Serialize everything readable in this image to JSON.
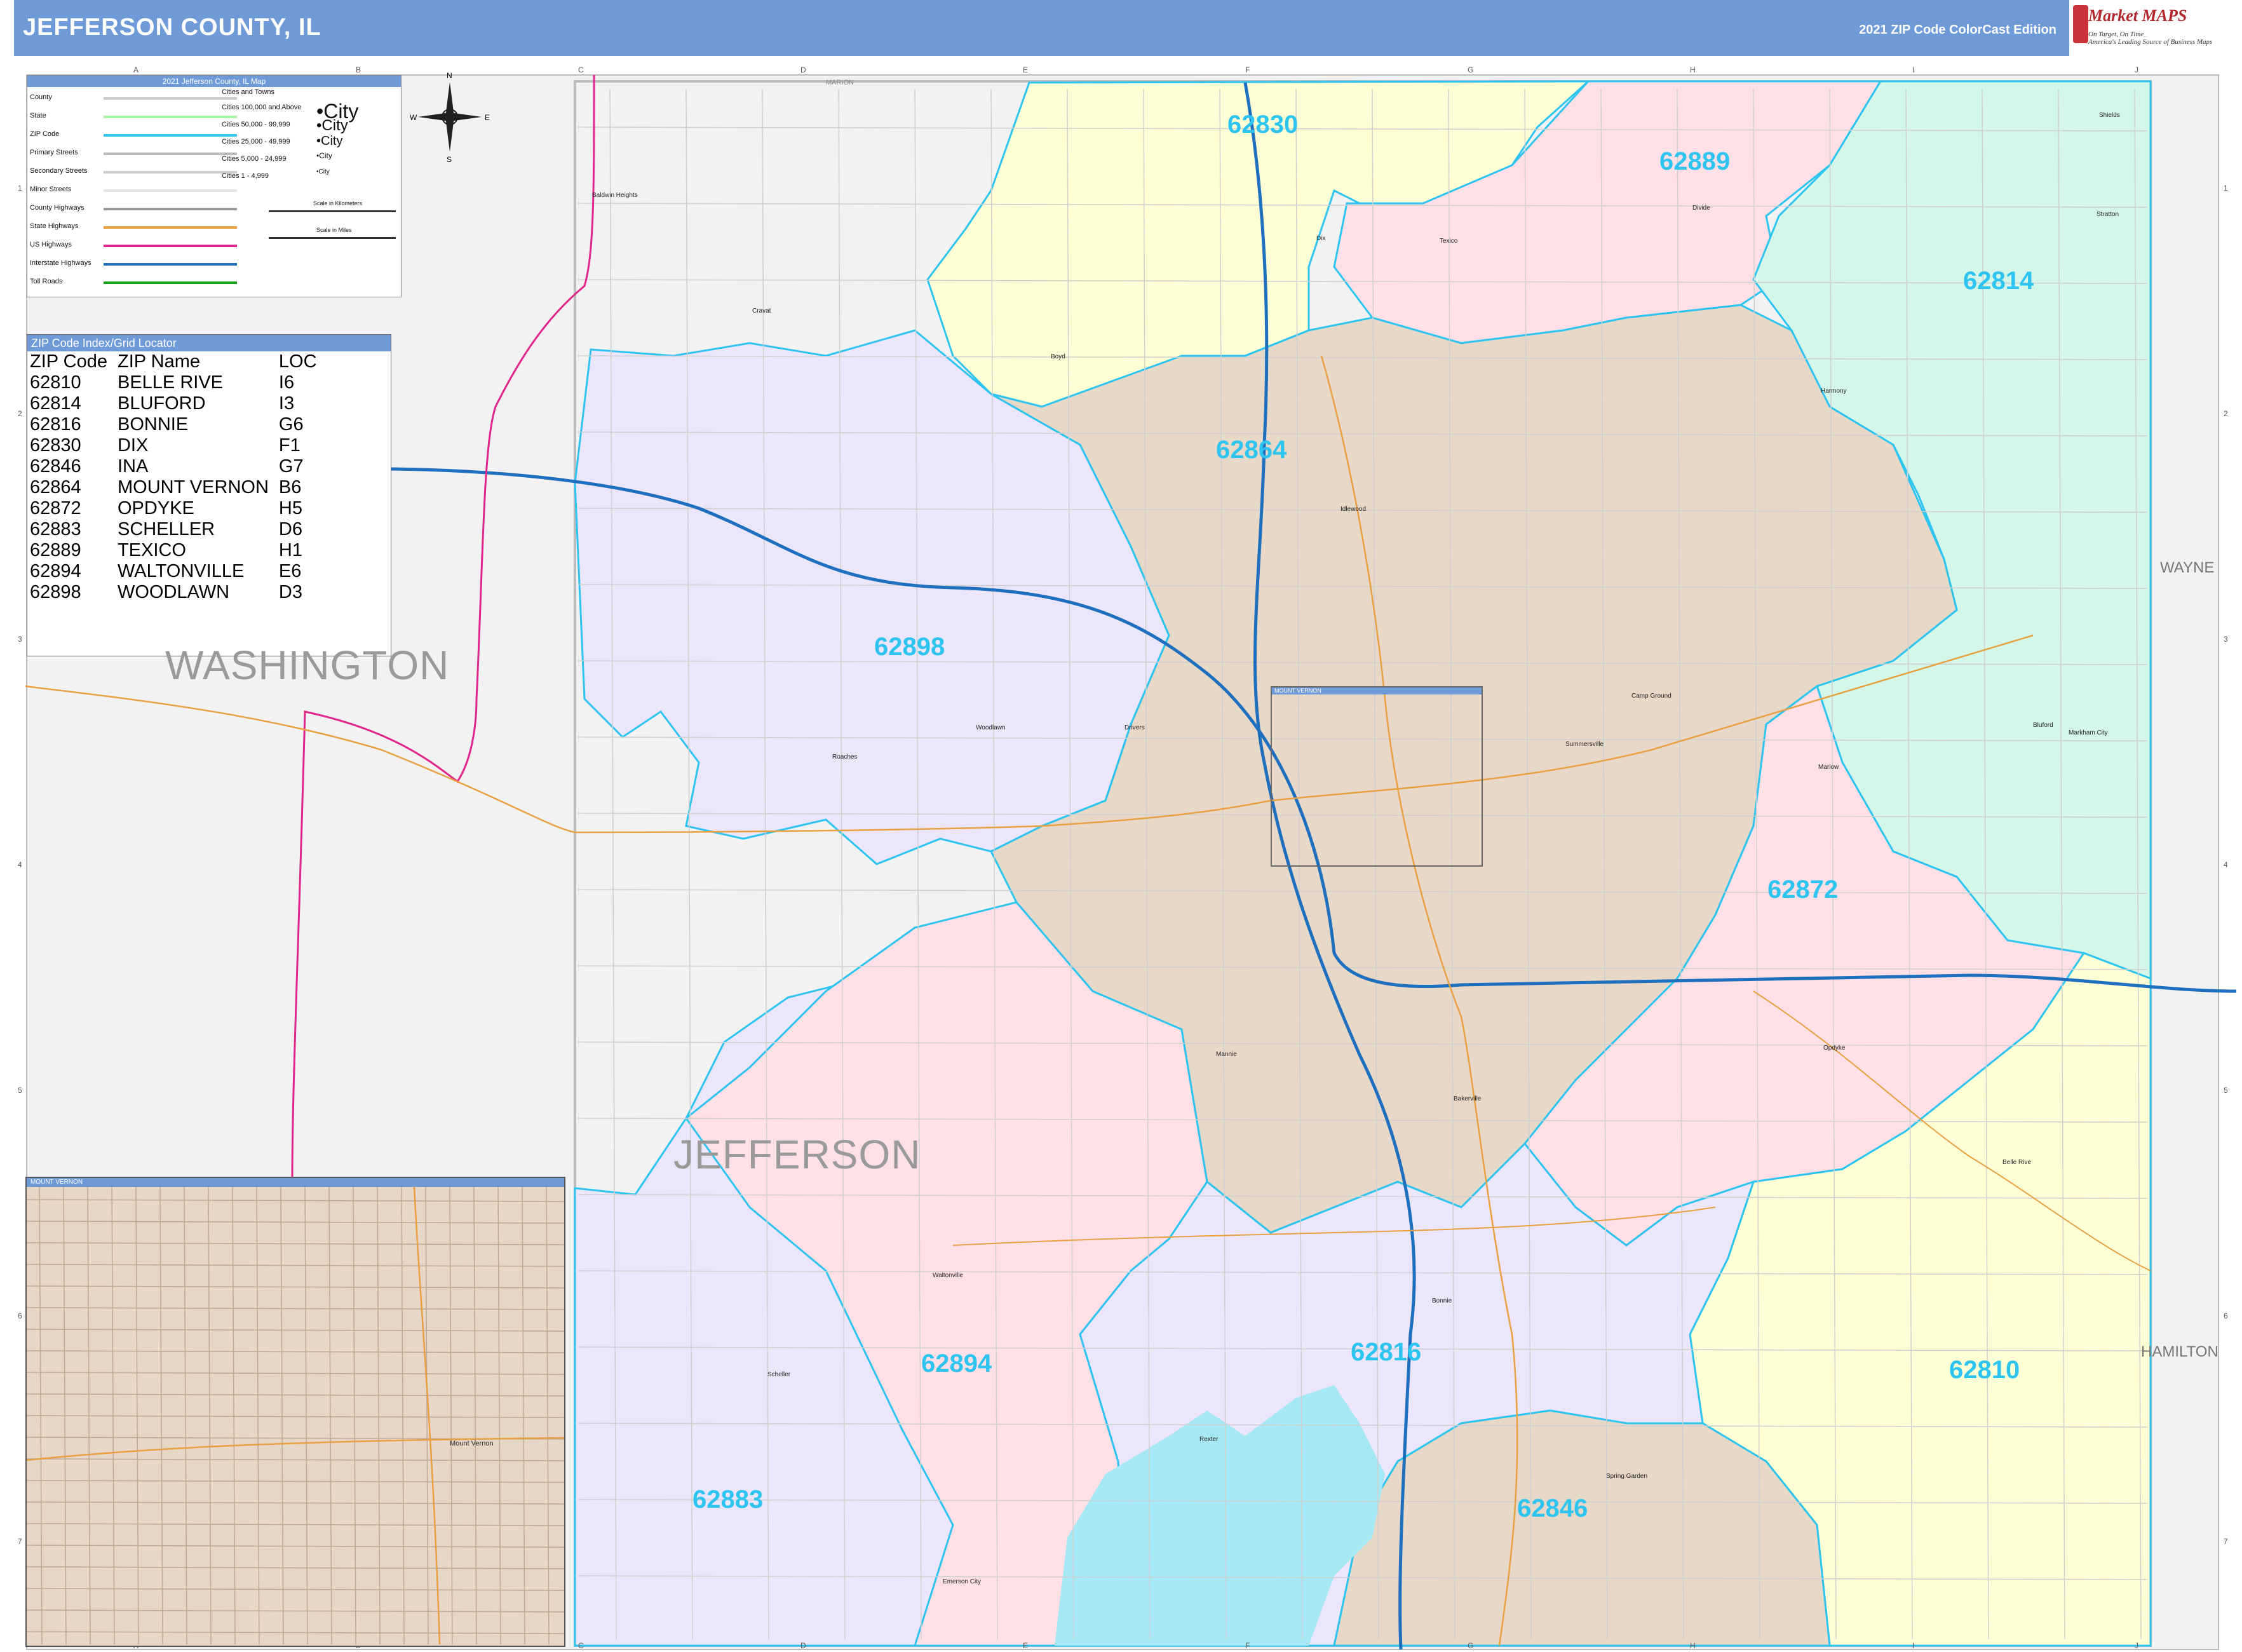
{
  "header": {
    "title": "JEFFERSON COUNTY, IL",
    "edition": "2021 ZIP Code ColorCast Edition"
  },
  "logo": {
    "brand": "Market MAPS",
    "tagline": "On Target, On Time",
    "subline": "America's Leading Source of Business Maps"
  },
  "legend": {
    "title": "2021 Jefferson County, IL Map",
    "rows": [
      "County",
      "State",
      "ZIP Code",
      "Primary Streets",
      "Secondary Streets",
      "Minor Streets",
      "County Highways",
      "State Highways",
      "US Highways",
      "Interstate Highways",
      "Toll Roads"
    ],
    "cities_header": "Cities and Towns",
    "city_classes": [
      "Cities 100,000 and Above",
      "Cities 50,000 - 99,999",
      "Cities 25,000 - 49,999",
      "Cities 5,000 - 24,999",
      "Cities 1 - 4,999"
    ],
    "city_samples": [
      "City",
      "City",
      "City",
      "City",
      "City"
    ],
    "scale_km": "Scale in Kilometers",
    "scale_mi": "Scale in Miles",
    "compass": [
      "N",
      "S",
      "E",
      "W"
    ],
    "colors": {
      "county": "#cccccc",
      "state": "#a6f2a6",
      "zip": "#2ec4f0",
      "primary": "#bbbbbb",
      "secondary": "#cccccc",
      "minor": "#e4e4e4",
      "county_hwy": "#999999",
      "state_hwy": "#e8a040",
      "us_hwy": "#e0268a",
      "interstate": "#1f6fbf",
      "toll": "#1aa31a"
    }
  },
  "zip_index": {
    "title": "ZIP Code Index/Grid Locator",
    "columns": [
      "ZIP Code",
      "ZIP Name",
      "LOC"
    ],
    "rows": [
      [
        "62810",
        "BELLE RIVE",
        "I6"
      ],
      [
        "62814",
        "BLUFORD",
        "I3"
      ],
      [
        "62816",
        "BONNIE",
        "G6"
      ],
      [
        "62830",
        "DIX",
        "F1"
      ],
      [
        "62846",
        "INA",
        "G7"
      ],
      [
        "62864",
        "MOUNT VERNON",
        "B6"
      ],
      [
        "62872",
        "OPDYKE",
        "H5"
      ],
      [
        "62883",
        "SCHELLER",
        "D6"
      ],
      [
        "62889",
        "TEXICO",
        "H1"
      ],
      [
        "62894",
        "WALTONVILLE",
        "E6"
      ],
      [
        "62898",
        "WOODLAWN",
        "D3"
      ]
    ]
  },
  "zip_labels": [
    {
      "zip": "62830"
    },
    {
      "zip": "62889"
    },
    {
      "zip": "62814"
    },
    {
      "zip": "62864"
    },
    {
      "zip": "62898"
    },
    {
      "zip": "62872"
    },
    {
      "zip": "62894"
    },
    {
      "zip": "62816"
    },
    {
      "zip": "62810"
    },
    {
      "zip": "62883"
    },
    {
      "zip": "62846"
    }
  ],
  "zip_colors": {
    "62830": "#ffffd6",
    "62889": "#ffe0e6",
    "62814": "#d4f7ea",
    "62864": "#e8d8c8",
    "62898": "#ece6fb",
    "62872": "#ffe0e6",
    "62894": "#ffe0e6",
    "62816": "#ece6fb",
    "62810": "#ffffd6",
    "62883": "#ece6fb",
    "62846": "#e8d8c8",
    "outside": "#f2f2f2",
    "lake": "#a6e8f5"
  },
  "counties": {
    "main": "JEFFERSON",
    "west": "WASHINGTON",
    "east_top": "WAYNE",
    "east_bottom": "HAMILTON",
    "north": "MARION"
  },
  "towns": [
    "Baldwin Heights",
    "Cravat",
    "Boyd",
    "Dix",
    "Texico",
    "Divide",
    "Shields",
    "Stratton",
    "Harmony",
    "Idlewood",
    "Camp Ground",
    "Bluford",
    "Markham City",
    "Marlow",
    "Summersville",
    "Woodlawn",
    "Roaches",
    "Drivers",
    "Mount Vernon",
    "Opdyke",
    "Belle Rive",
    "Bakerville",
    "Mannie",
    "Waltonville",
    "Scheller",
    "Bonnie",
    "Rexter",
    "Spring Garden",
    "Emerson City"
  ],
  "inset": {
    "title": "MOUNT VERNON",
    "town": "Mount Vernon"
  },
  "vernon_box": {
    "title": "MOUNT VERNON"
  },
  "grid": {
    "columns": [
      "A",
      "B",
      "C",
      "D",
      "E",
      "F",
      "G",
      "H",
      "I",
      "J"
    ],
    "rows": [
      "1",
      "2",
      "3",
      "4",
      "5",
      "6",
      "7"
    ]
  }
}
